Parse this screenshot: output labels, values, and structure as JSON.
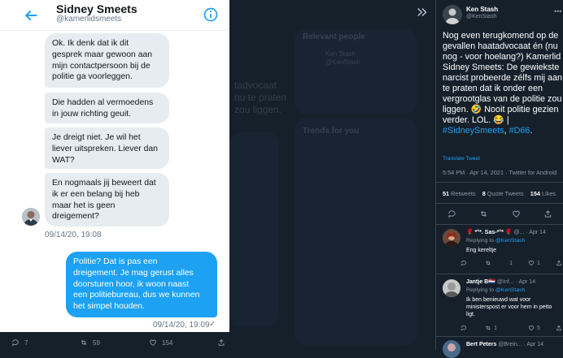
{
  "dm": {
    "name": "Sidney Smeets",
    "handle": "@kamerlidsmeets",
    "messages": [
      {
        "text": "Ok. Ik denk dat ik dit\ngesprek maar gewoon aan\nmijn contactpersoon bij de\npolitie ga voorleggen.",
        "direction": "in"
      },
      {
        "text": "Die hadden al vermoedens\nin jouw richting geuit.",
        "direction": "in"
      },
      {
        "text": "Je dreigt niet. Je wil het\nliever uitspreken. Liever dan\nWAT?",
        "direction": "in"
      },
      {
        "text": "En nogmaals jij beweert dat\nik er een belang bij heb\nmaar het is geen\ndreigement?",
        "direction": "in"
      },
      {
        "text": "Politie? Dat is pas een\ndreigement. Je mag gerust alles\ndoorsturen hoor, ik woon naast\neen politiebureau, dus we kunnen\nhet simpel houden.",
        "direction": "out"
      }
    ],
    "timestamp_in": "09/14/20, 19:08",
    "timestamp_out": "09/14/20, 19:09",
    "seen_mark": "✓",
    "accent": "#1da1f2"
  },
  "background": {
    "sections": [
      "Relevant people",
      "Trends for you"
    ],
    "people_name": "Ken Stash",
    "people_handle": "@KenStash",
    "fragments": [
      "tadvocaat",
      "nu te praten",
      "zou liggen."
    ]
  },
  "tweet_actions": {
    "replies": "7",
    "retweets": "59",
    "likes": "154"
  },
  "right_tweet": {
    "name": "Ken Stash",
    "handle": "@KenStash",
    "text_plain": "Nog even terugkomend op de gevallen haatadvocaat én (nu nog - voor hoelang?) Kamerlid Sidney Smeets: De gewiekste narcist probeerde zélfs mij aan te praten dat ik onder een vergrootglas van de politie zou liggen. 🤣 Nooit politie gezien verder. LOL. 😂 | ",
    "hashtag1": "#SidneySmeets",
    "separator": ",",
    "hashtag2": "#D66",
    "translate": "Translate Tweet",
    "time": "5:54 PM · Apr 14, 2021 · Twitter for Android",
    "retweets": "51",
    "retweets_label": "Retweets",
    "quotes": "8",
    "quotes_label": "Quote Tweets",
    "likes": "154",
    "likes_label": "Likes"
  },
  "replies": [
    {
      "name": "🌹 *°*. Sas-*°* 🌹",
      "meta": "@... · Apr 14",
      "replying": "Replying to",
      "to": "@KenStash",
      "text": "Eng kereltje",
      "counts": [
        "",
        "",
        "1",
        "1"
      ]
    },
    {
      "name": "Jantje B🇳🇱",
      "meta": "@Inf... · Apr 14",
      "replying": "Replying to",
      "to": "@KenStash",
      "text": "Ik ben benieuwd wat voor ministerspost er voor hem in petto ligt.",
      "counts": [
        "",
        "1",
        "",
        "5"
      ]
    },
    {
      "name": "Bert Peters",
      "meta": "@Brein... · Apr 14",
      "replying": "",
      "to": "",
      "text": "",
      "counts": [
        "",
        "",
        "",
        ""
      ]
    }
  ]
}
